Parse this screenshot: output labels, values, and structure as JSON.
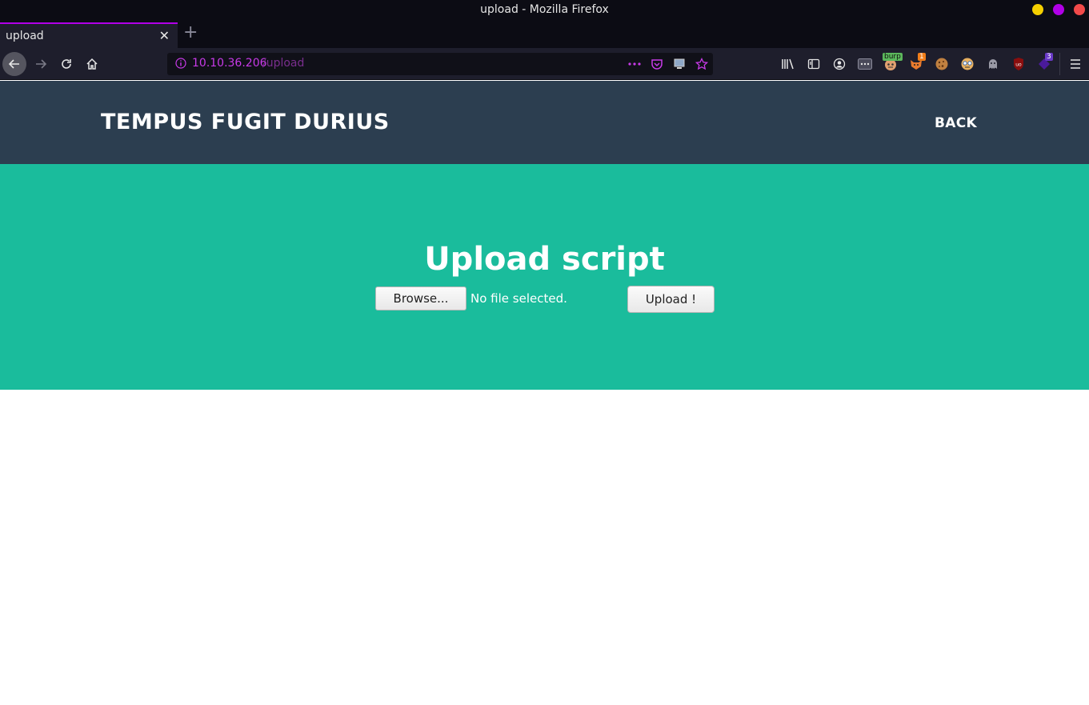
{
  "window": {
    "title": "upload - Mozilla Firefox"
  },
  "tabs": [
    {
      "label": "upload",
      "close": "✕"
    }
  ],
  "newtab": "+",
  "urlbar": {
    "host": "10.10.36.206",
    "path": "/upload"
  },
  "toolbar": {
    "burp_badge": "burp",
    "ext_badge": "1",
    "count_badge": "3"
  },
  "page": {
    "site_title": "TEMPUS FUGIT DURIUS",
    "back_label": "BACK",
    "hero_title": "Upload script",
    "browse_label": "Browse...",
    "file_status": "No file selected.",
    "upload_label": "Upload !"
  },
  "colors": {
    "header_bg": "#2c3e50",
    "hero_bg": "#1abc9c",
    "accent": "#b100e8"
  }
}
